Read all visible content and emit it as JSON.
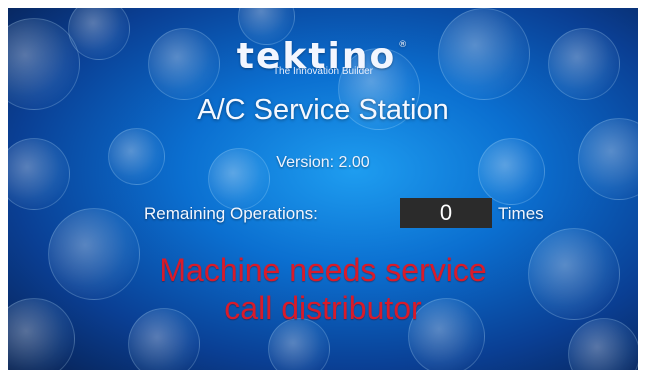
{
  "brand": {
    "logo_text": "tektino",
    "logo_mark": "®",
    "tagline": "The Innovation Builder"
  },
  "screen": {
    "title": "A/C Service Station",
    "version": "Version: 2.00",
    "remaining_label": "Remaining Operations:",
    "remaining_value": "0",
    "remaining_unit": "Times",
    "alert_line1": "Machine needs service",
    "alert_line2": "call distributor"
  },
  "colors": {
    "background_blue": "#0b6fd0",
    "alert_red": "#d81b2a",
    "counter_box": "#2b2b2b"
  }
}
